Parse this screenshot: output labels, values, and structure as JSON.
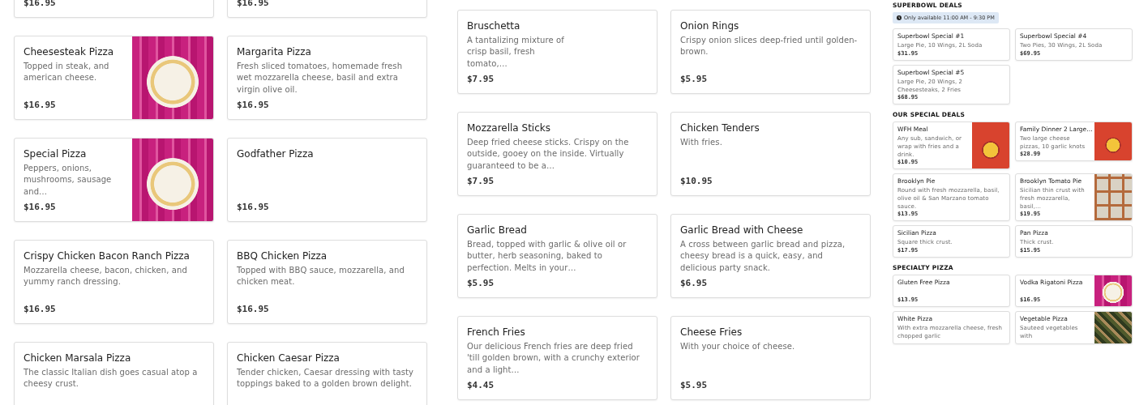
{
  "columns": [
    {
      "sections": [
        {
          "items": [
            {
              "price": "$16.95"
            },
            {
              "price": "$16.95"
            },
            {
              "name": "Cheesesteak Pizza",
              "description": "Topped in steak, and american cheese.",
              "price": "$16.95",
              "kind": "plate-photo"
            },
            {
              "name": "Margarita Pizza",
              "description": "Fresh sliced tomatoes, homemade fresh wet mozzarella cheese, basil and extra virgin olive oil.",
              "price": "$16.95"
            },
            {
              "name": "Special Pizza",
              "description": "Peppers, onions, mushrooms, sausage and…",
              "price": "$16.95",
              "kind": "plate-photo"
            },
            {
              "name": "Godfather Pizza",
              "price": "$16.95"
            },
            {
              "name": "Crispy Chicken Bacon Ranch Pizza",
              "description": "Mozzarella cheese, bacon, chicken, and yummy ranch dressing.",
              "price": "$16.95"
            },
            {
              "name": "BBQ Chicken Pizza",
              "description": "Topped with BBQ sauce, mozzarella, and chicken meat.",
              "price": "$16.95"
            },
            {
              "name": "Chicken Marsala Pizza",
              "description": "The classic Italian dish goes casual atop a cheesy crust."
            },
            {
              "name": "Chicken Caesar Pizza",
              "description": "Tender chicken, Caesar dressing with tasty toppings baked to a golden brown delight."
            }
          ]
        }
      ]
    },
    {
      "sections": [
        {
          "items": [
            {
              "name": "Bruschetta",
              "description": "A tantalizing mixture of crisp basil, fresh tomato,…",
              "price": "$7.95",
              "kind": "narrow-text"
            },
            {
              "name": "Onion Rings",
              "description": "Crispy onion slices deep-fried until golden-brown.",
              "price": "$5.95"
            },
            {
              "name": "Mozzarella Sticks",
              "description": "Deep fried cheese sticks. Crispy on the outside, gooey on the inside. Virtually guaranteed to be a…",
              "price": "$7.95"
            },
            {
              "name": "Chicken Tenders",
              "description": "With fries.",
              "price": "$10.95"
            },
            {
              "name": "Garlic Bread",
              "description": "Bread, topped with garlic & olive oil or butter, herb seasoning, baked to perfection. Melts in your…",
              "price": "$5.95"
            },
            {
              "name": "Garlic Bread with Cheese",
              "description": "A cross between garlic bread and pizza, cheesy bread is a quick, easy, and delicious party snack.",
              "price": "$6.95"
            },
            {
              "name": "French Fries",
              "description": "Our delicious French fries are deep fried 'till golden brown, with a crunchy exterior and a light…",
              "price": "$4.45"
            },
            {
              "name": "Cheese Fries",
              "description": "With your choice of cheese.",
              "price": "$5.95"
            }
          ]
        }
      ]
    },
    {
      "sections": [
        {
          "heading": "SUPERBOWL DEALS",
          "note": "Only available 11:00 AM - 9:30 PM",
          "items": [
            {
              "name": "Superbowl Special #1",
              "description": "Large Pie, 10 Wings, 2L Soda",
              "price": "$31.95"
            },
            {
              "name": "Superbowl Special #4",
              "description": "Two Pies, 30 Wings, 2L Soda",
              "price": "$69.95"
            },
            {
              "name": "Superbowl Special #5",
              "description": "Large Pie, 20 Wings, 2 Cheesesteaks, 2 Fries",
              "price": "$68.95"
            }
          ]
        },
        {
          "heading": "OUR SPECIAL DEALS",
          "items": [
            {
              "name": "WFH Meal",
              "description": "Any sub, sandwich, or wrap with fries and a drink.",
              "price": "$10.95",
              "kind": "logo-image"
            },
            {
              "name": "Family Dinner 2 Large…",
              "description": "Two large cheese pizzas, 10 garlic knots",
              "price": "$28.99",
              "kind": "logo-image"
            },
            {
              "name": "Brooklyn Pie",
              "description": "Round with fresh mozzarella, basil, olive oil & San Marzano tomato sauce.",
              "price": "$13.95"
            },
            {
              "name": "Brooklyn Tomato Pie",
              "description": "Sicilian thin crust with fresh mozzarella, basil,…",
              "price": "$19.95",
              "kind": "tray-photo"
            },
            {
              "name": "Sicilian Pizza",
              "description": "Square thick crust.",
              "price": "$17.95"
            },
            {
              "name": "Pan Pizza",
              "description": "Thick crust.",
              "price": "$15.95"
            }
          ]
        },
        {
          "heading": "SPECIALTY PIZZA",
          "items": [
            {
              "name": "Gluten Free Pizza",
              "price": "$13.95"
            },
            {
              "name": "Vodka Rigatoni Pizza",
              "price": "$16.95",
              "kind": "plate-photo"
            },
            {
              "name": "White Pizza",
              "description": "With extra mozzarella cheese, fresh chopped garlic"
            },
            {
              "name": "Vegetable Pizza",
              "description": "Sauteed vegetables with",
              "kind": "veggie-photo"
            }
          ]
        }
      ]
    }
  ]
}
